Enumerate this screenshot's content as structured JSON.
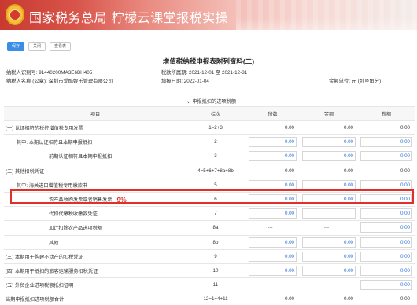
{
  "header": {
    "title": "国家税务总局  柠檬云课堂报税实操"
  },
  "toolbar": {
    "save": "保存",
    "close": "关闭",
    "view": "查看表"
  },
  "doc": {
    "title": "增值税纳税申报表附列资料(二)",
    "taxpayer_id_label": "纳税人识别号:",
    "taxpayer_id": "91440200MA3E6BH405",
    "period_label": "税款所属期:",
    "period": "2021-12-01 至 2021-12-31",
    "name_label": "纳税人名称 (公章):",
    "name": "深圳市爱酷娱乐管理有限公司",
    "filled_label": "填报日期:",
    "filled_date": "2022-01-04",
    "unit_label": "金额单位:",
    "unit": "元 (列至角分)"
  },
  "table": {
    "headers": [
      "项目",
      "栏次",
      "份数",
      "金额",
      "税额"
    ],
    "section_title": "一、申报抵扣的进项税额",
    "rows": [
      {
        "name": "(一) 认证相符的税控增值税专用发票",
        "lane": "1=2+3",
        "count": "0.00",
        "amount": "0.00",
        "tax": "0.00",
        "indent": 0,
        "boxed": false
      },
      {
        "name": "其中:  本期认证相符且本期申报抵扣",
        "lane": "2",
        "count": "0.00",
        "amount": "0.00",
        "tax": "0.00",
        "indent": 1,
        "boxed": true
      },
      {
        "name": "前期认证相符且本期申报抵扣",
        "lane": "3",
        "count": "0.00",
        "amount": "0.00",
        "tax": "0.00",
        "indent": 2,
        "boxed": true
      },
      {
        "name": "(二) 其他扣税凭证",
        "lane": "4=5+6+7+8a+8b",
        "count": "0.00",
        "amount": "0.00",
        "tax": "0.00",
        "indent": 0,
        "boxed": false
      },
      {
        "name": "其中:  海关进口增值税专用缴款书",
        "lane": "5",
        "count": "0.00",
        "amount": "0.00",
        "tax": "0.00",
        "indent": 1,
        "boxed": true
      },
      {
        "name": "农产品收购发票或者销售发票",
        "lane": "6",
        "count": "0.00",
        "amount": "0.00",
        "tax": "0.00",
        "indent": 2,
        "boxed": true,
        "note": "9%"
      },
      {
        "name": "代扣代缴税收缴款凭证",
        "lane": "7",
        "count": "0.00",
        "amount": "",
        "tax": "0.00",
        "indent": 2,
        "boxed": true
      },
      {
        "name": "加计扣除农产品进项税额",
        "lane": "8a",
        "count": "---",
        "amount": "---",
        "tax": "0.00",
        "indent": 2,
        "boxed": true
      },
      {
        "name": "其他",
        "lane": "8b",
        "count": "0.00",
        "amount": "0.00",
        "tax": "0.00",
        "indent": 2,
        "boxed": true
      },
      {
        "name": "(三) 本期用于购建不动产的扣税凭证",
        "lane": "9",
        "count": "0.00",
        "amount": "0.00",
        "tax": "0.00",
        "indent": 0,
        "boxed": true
      },
      {
        "name": "(四) 本期用于抵扣的旅客运输服务扣税凭证",
        "lane": "10",
        "count": "0.00",
        "amount": "0.00",
        "tax": "0.00",
        "indent": 0,
        "boxed": true
      },
      {
        "name": "(五) 外贸企业进项税额抵扣证明",
        "lane": "11",
        "count": "---",
        "amount": "---",
        "tax": "0.00",
        "indent": 0,
        "boxed": true
      },
      {
        "name": "当期申报抵扣进项税额合计",
        "lane": "12=1+4+11",
        "count": "0.00",
        "amount": "0.00",
        "tax": "0.00",
        "indent": -1,
        "boxed": false
      }
    ]
  }
}
